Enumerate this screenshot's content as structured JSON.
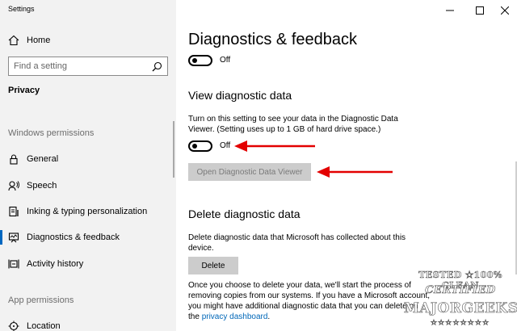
{
  "window": {
    "title": "Settings",
    "controls": {
      "minimize": "—",
      "maximize": "☐",
      "close": "✕"
    }
  },
  "sidebar": {
    "home_label": "Home",
    "search_placeholder": "Find a setting",
    "category_label": "Privacy",
    "sections": [
      {
        "label": "Windows permissions",
        "items": [
          {
            "label": "General",
            "icon": "lock-icon"
          },
          {
            "label": "Speech",
            "icon": "speech-icon"
          },
          {
            "label": "Inking & typing personalization",
            "icon": "document-pen-icon"
          },
          {
            "label": "Diagnostics & feedback",
            "icon": "diagnostics-icon",
            "selected": true
          },
          {
            "label": "Activity history",
            "icon": "activity-icon"
          }
        ]
      },
      {
        "label": "App permissions",
        "items": [
          {
            "label": "Location",
            "icon": "location-icon"
          }
        ]
      }
    ]
  },
  "main": {
    "title": "Diagnostics & feedback",
    "top_toggle": {
      "state": "Off"
    },
    "view_section": {
      "heading": "View diagnostic data",
      "description": "Turn on this setting to see your data in the Diagnostic Data Viewer. (Setting uses up to 1 GB of hard drive space.)",
      "toggle_state": "Off",
      "button_label": "Open Diagnostic Data Viewer"
    },
    "delete_section": {
      "heading": "Delete diagnostic data",
      "description": "Delete diagnostic data that Microsoft has collected about this device.",
      "button_label": "Delete",
      "note": "Once you choose to delete your data, we'll start the process of removing copies from our systems. If you have a Microsoft account, you might have additional diagnostic data that you can delete on the",
      "link_label": "privacy dashboard",
      "note_end": "."
    }
  },
  "watermark": {
    "line1": "TESTED ★100% CLEAN",
    "line2": "CERTIFIED",
    "line3": "MAJORGEEKS",
    "stars": "★★★★★★★★"
  },
  "colors": {
    "sidebar_bg": "#f2f2f2",
    "accent": "#0067c0",
    "link": "#0067b8",
    "annotation_arrow": "#e30000"
  }
}
